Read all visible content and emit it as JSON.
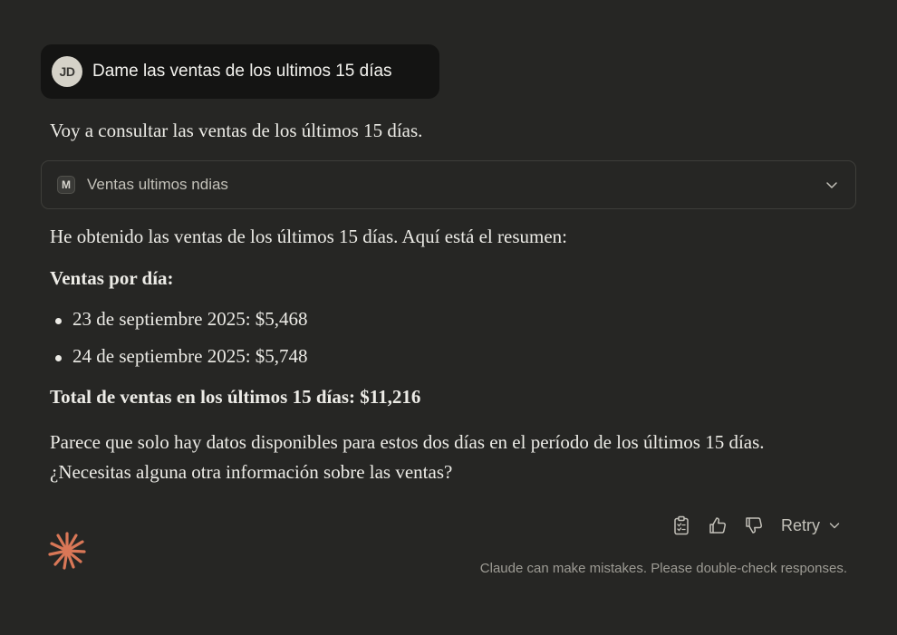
{
  "user_message": {
    "avatar_initials": "JD",
    "text": "Dame las ventas de los ultimos 15 días"
  },
  "assistant": {
    "intro": "Voy a consultar las ventas de los últimos 15 días.",
    "tool_call": {
      "badge": "M",
      "label": "Ventas ultimos ndias",
      "icon": "chevron-down-icon"
    },
    "summary": "He obtenido las ventas de los últimos 15 días. Aquí está el resumen:",
    "heading": "Ventas por día:",
    "sales": [
      "23 de septiembre 2025: $5,468",
      "24 de septiembre 2025: $5,748"
    ],
    "total": "Total de ventas en los últimos 15 días: $11,216",
    "closing": "Parece que solo hay datos disponibles para estos dos días en el período de los últimos 15 días. ¿Necesitas alguna otra información sobre las ventas?"
  },
  "actions": {
    "copy_icon": "clipboard-icon",
    "like_icon": "thumbs-up-icon",
    "dislike_icon": "thumbs-down-icon",
    "retry_label": "Retry"
  },
  "footer": {
    "disclaimer": "Claude can make mistakes. Please double-check responses."
  },
  "colors": {
    "background": "#262624",
    "user_bubble": "#141413",
    "accent": "#d97757"
  }
}
